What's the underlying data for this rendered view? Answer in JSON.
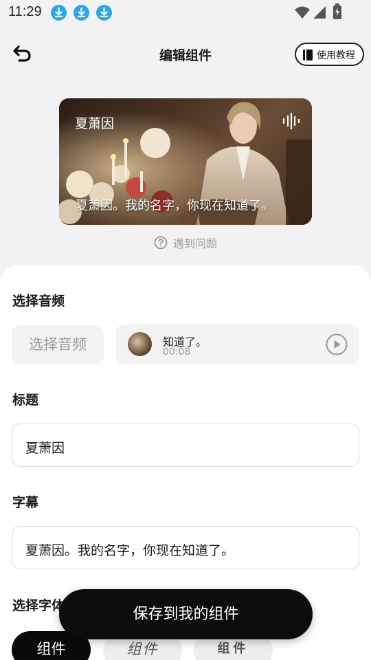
{
  "status_bar": {
    "time": "11:29",
    "notification_icons": [
      "download-icon",
      "download-icon",
      "download-icon"
    ],
    "accent_color": "#2aa7e8"
  },
  "header": {
    "title": "编辑组件",
    "back_icon": "back-arrow-icon",
    "tutorial_label": "使用教程",
    "tutorial_icon": "book-icon"
  },
  "preview": {
    "title": "夏萧因",
    "subtitle": "夏萧因。我的名字，你现在知道了。",
    "wave_icon": "sound-wave-icon"
  },
  "help": {
    "label": "遇到问题",
    "icon": "question-circle-icon"
  },
  "audio_section": {
    "label": "选择音频",
    "choose_button": "选择音频",
    "current_audio": {
      "name": "知道了。",
      "duration": "00:08",
      "play_icon": "play-circle-icon"
    }
  },
  "title_section": {
    "label": "标题",
    "value": "夏萧因"
  },
  "subtitle_section": {
    "label": "字幕",
    "value": "夏萧因。我的名字，你现在知道了。"
  },
  "font_section": {
    "label": "选择字体",
    "options": [
      "组件",
      "组件",
      "组件"
    ],
    "selected_index": 0
  },
  "save_button": "保存到我的组件"
}
